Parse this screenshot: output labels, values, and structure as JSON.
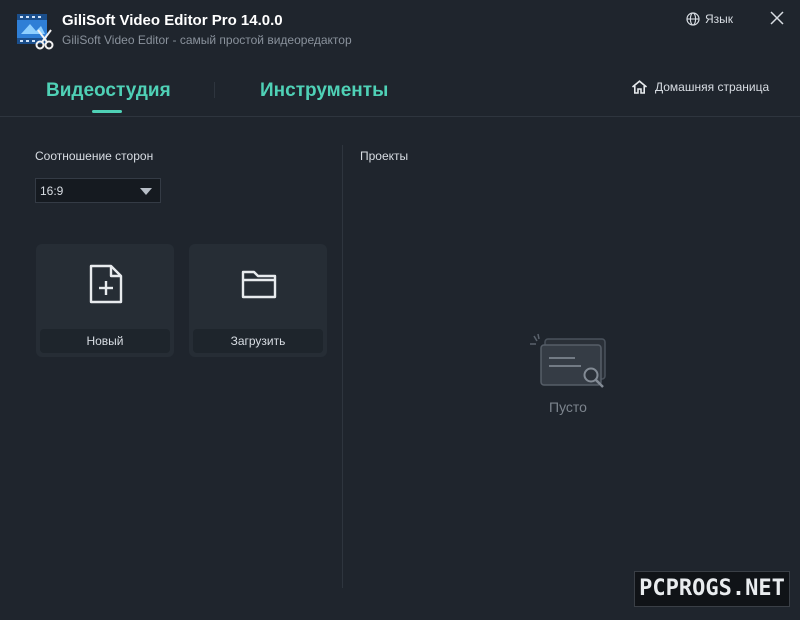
{
  "window": {
    "title": "GiliSoft Video Editor Pro 14.0.0",
    "subtitle": "GiliSoft Video Editor - самый простой видеоредактор",
    "language_label": "Язык",
    "logo_icon": "film-scissors-icon",
    "close_icon": "close-icon"
  },
  "tabs": {
    "items": [
      {
        "label": "Видеостудия",
        "active": true
      },
      {
        "label": "Инструменты",
        "active": false
      }
    ],
    "home_label": "Домашняя страница"
  },
  "left_panel": {
    "aspect_label": "Соотношение сторон",
    "aspect_value": "16:9",
    "cards": [
      {
        "label": "Новый",
        "icon": "new-file-icon"
      },
      {
        "label": "Загрузить",
        "icon": "folder-icon"
      }
    ]
  },
  "right_panel": {
    "projects_label": "Проекты",
    "empty_text": "Пусто",
    "empty_icon": "empty-document-search-icon"
  },
  "watermark": "PCPROGS.NET",
  "colors": {
    "background": "#1f252d",
    "accent": "#4fd1b6",
    "card": "#262d35"
  }
}
